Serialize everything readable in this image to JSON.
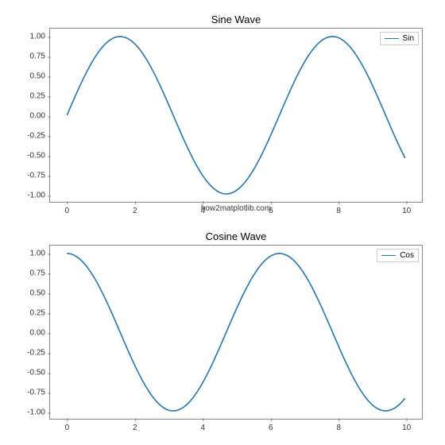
{
  "chart_data": [
    {
      "type": "line",
      "title": "Sine Wave",
      "xlabel": "",
      "ylabel": "",
      "xlim": [
        -0.5,
        10.5
      ],
      "ylim": [
        -1.1,
        1.1
      ],
      "xticks": [
        0,
        2,
        4,
        6,
        8,
        10
      ],
      "yticks": [
        -1.0,
        -0.75,
        -0.5,
        -0.25,
        0.0,
        0.25,
        0.5,
        0.75,
        1.0
      ],
      "series": [
        {
          "name": "Sin",
          "function": "sin",
          "x_range": [
            0,
            10
          ],
          "n_points": 100
        }
      ],
      "legend_position": "upper right",
      "caption": "how2matplotlib.com"
    },
    {
      "type": "line",
      "title": "Cosine Wave",
      "xlabel": "",
      "ylabel": "",
      "xlim": [
        -0.5,
        10.5
      ],
      "ylim": [
        -1.1,
        1.1
      ],
      "xticks": [
        0,
        2,
        4,
        6,
        8,
        10
      ],
      "yticks": [
        -1.0,
        -0.75,
        -0.5,
        -0.25,
        0.0,
        0.25,
        0.5,
        0.75,
        1.0
      ],
      "series": [
        {
          "name": "Cos",
          "function": "cos",
          "x_range": [
            0,
            10
          ],
          "n_points": 100
        }
      ],
      "legend_position": "upper right"
    }
  ]
}
